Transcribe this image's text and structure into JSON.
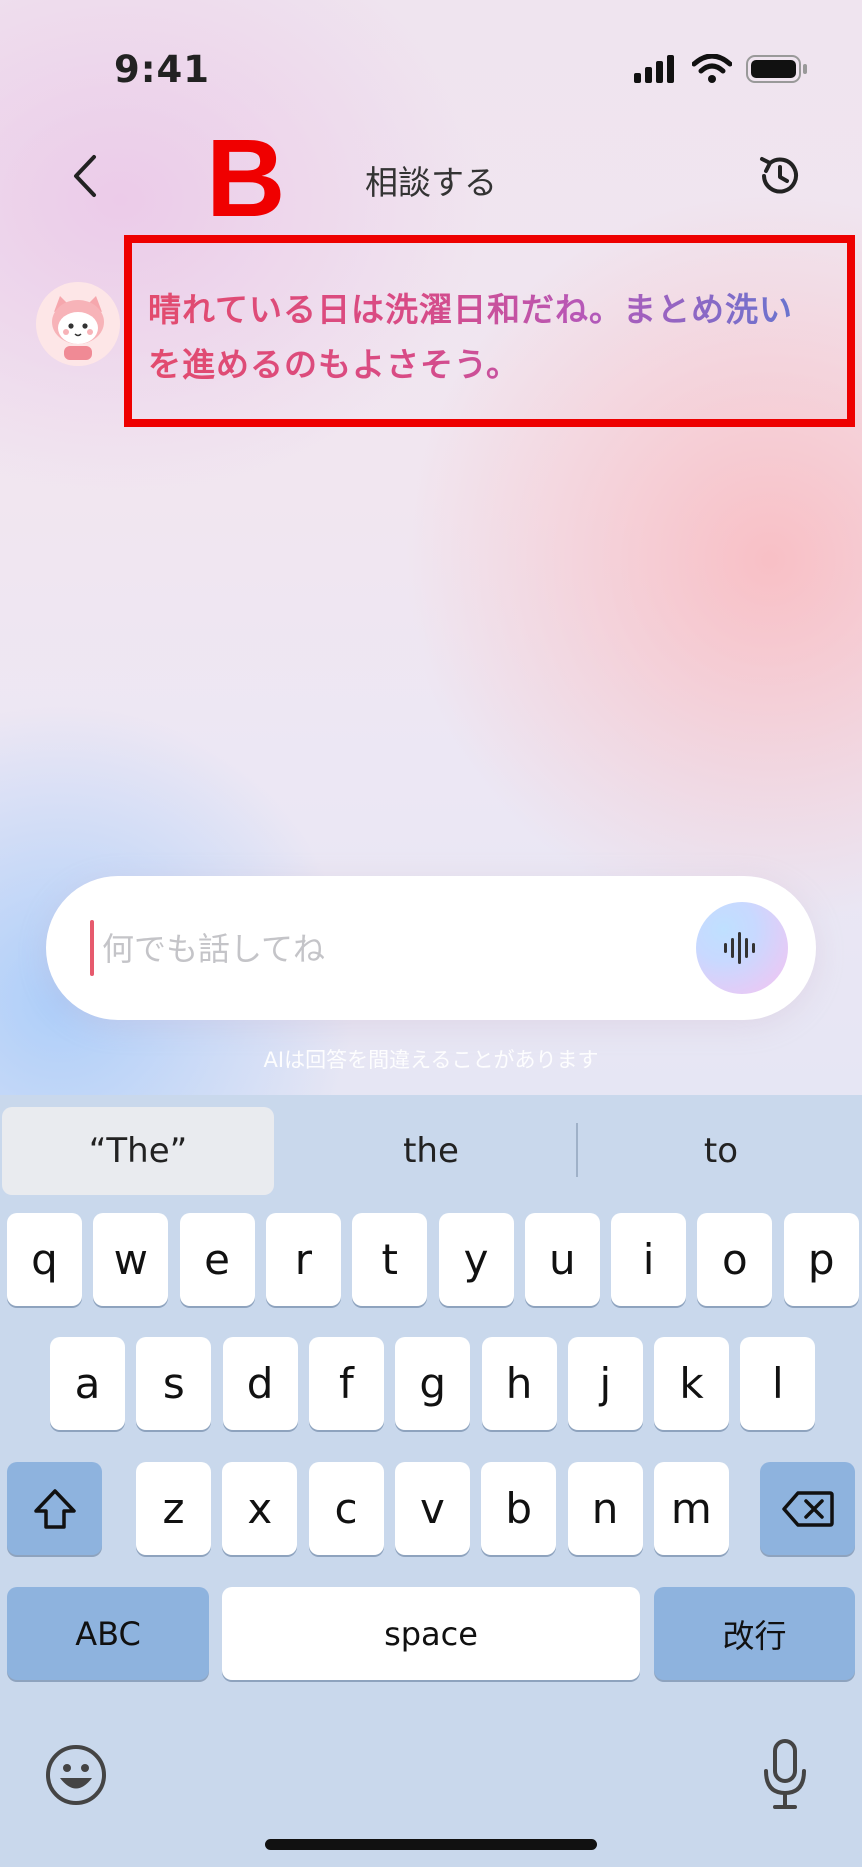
{
  "status_bar": {
    "time": "9:41"
  },
  "nav": {
    "title": "相談する"
  },
  "annotation": {
    "letter": "B"
  },
  "message": {
    "text": "晴れている日は洗濯日和だね。まとめ洗いを進めるのもよさそう。"
  },
  "input": {
    "placeholder": "何でも話してね"
  },
  "disclaimer": "AIは回答を間違えることがあります",
  "keyboard": {
    "suggestions": [
      "“The”",
      "the",
      "to"
    ],
    "row1": [
      "q",
      "w",
      "e",
      "r",
      "t",
      "y",
      "u",
      "i",
      "o",
      "p"
    ],
    "row2": [
      "a",
      "s",
      "d",
      "f",
      "g",
      "h",
      "j",
      "k",
      "l"
    ],
    "row3": [
      "z",
      "x",
      "c",
      "v",
      "b",
      "n",
      "m"
    ],
    "abc_label": "ABC",
    "space_label": "space",
    "return_label": "改行"
  },
  "colors": {
    "annotation_red": "#ee0000",
    "caret": "#e65a6d",
    "keyboard_bg": "#c9d8ec"
  },
  "icons": [
    "back-icon",
    "history-icon",
    "signal-icon",
    "wifi-icon",
    "battery-icon",
    "voice-wave-icon",
    "shift-icon",
    "backspace-icon",
    "emoji-icon",
    "dictation-mic-icon"
  ]
}
